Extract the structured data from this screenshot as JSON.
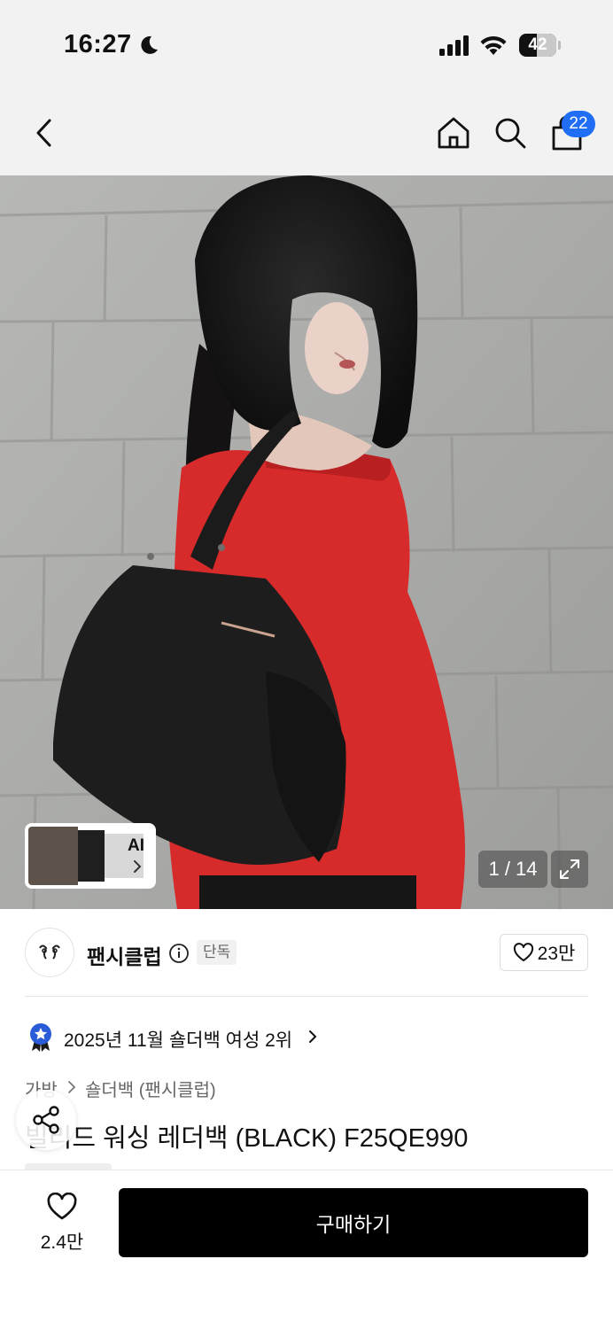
{
  "status_bar": {
    "time": "16:27",
    "battery": "42"
  },
  "nav": {
    "cart_count": "22"
  },
  "hero": {
    "ai_label": "AI",
    "counter": "1 / 14"
  },
  "brand": {
    "name": "팬시클럽",
    "exclusive_badge": "단독",
    "likes": "23만"
  },
  "ranking": {
    "text": "2025년 11월 숄더백 여성 2위"
  },
  "breadcrumb": [
    "가방",
    "숄더백 (팬시클럽)"
  ],
  "product": {
    "title": "빌리드 워싱 레더백 (BLACK) F25QE990"
  },
  "bottom": {
    "wish_count": "2.4만",
    "buy_label": "구매하기"
  },
  "colors": {
    "accent_blue": "#1f6ef5",
    "button_black": "#000000",
    "sweater_red": "#d72a2a"
  },
  "icons": [
    "moon-icon",
    "signal-icon",
    "wifi-icon",
    "back-icon",
    "home-icon",
    "search-icon",
    "cart-icon",
    "chevron-right-icon",
    "expand-icon",
    "info-icon",
    "heart-icon",
    "rank-badge-icon",
    "share-icon"
  ]
}
